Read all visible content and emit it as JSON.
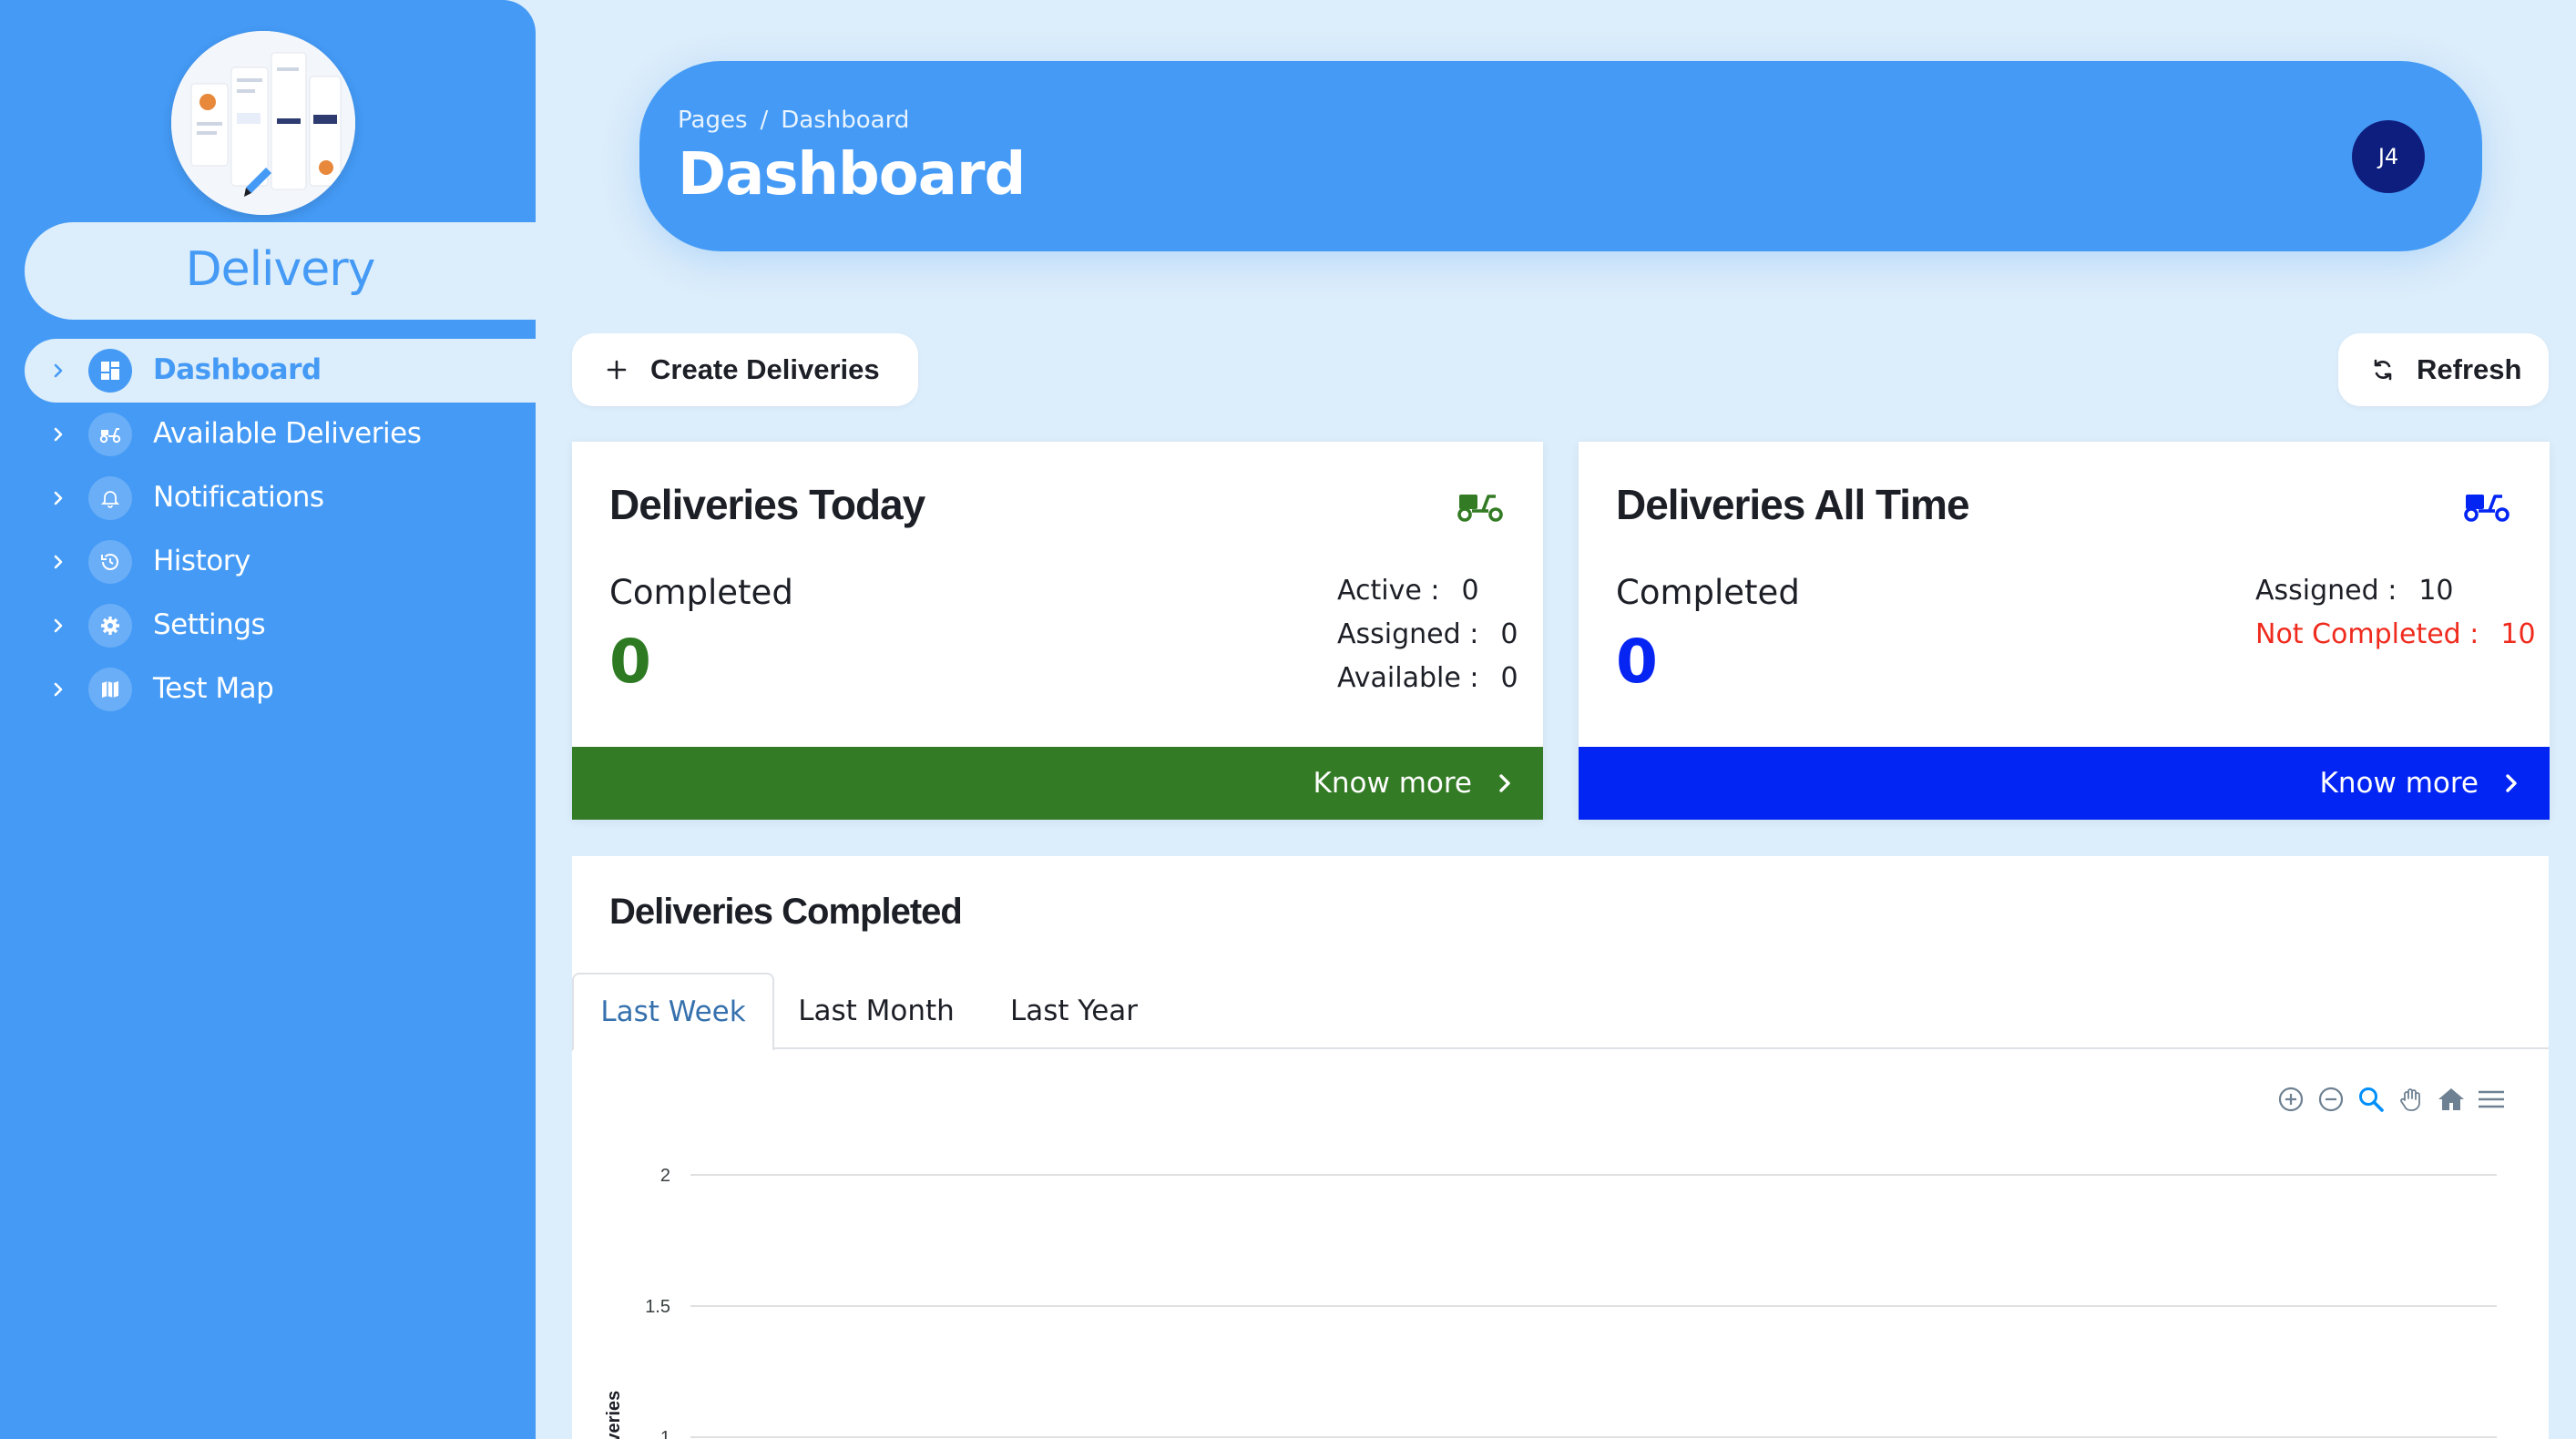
{
  "sidebar": {
    "brand": "Delivery",
    "items": [
      {
        "label": "Dashboard",
        "icon": "dashboard-grid-icon",
        "active": true
      },
      {
        "label": "Available Deliveries",
        "icon": "scooter-icon",
        "active": false
      },
      {
        "label": "Notifications",
        "icon": "bell-icon",
        "active": false
      },
      {
        "label": "History",
        "icon": "history-icon",
        "active": false
      },
      {
        "label": "Settings",
        "icon": "gear-icon",
        "active": false
      },
      {
        "label": "Test Map",
        "icon": "map-icon",
        "active": false
      }
    ]
  },
  "header": {
    "breadcrumb": [
      "Pages",
      "Dashboard"
    ],
    "separator": "/",
    "title": "Dashboard",
    "user_initials": "J4"
  },
  "actions": {
    "create_label": "Create Deliveries",
    "refresh_label": "Refresh"
  },
  "cards": {
    "today": {
      "title": "Deliveries Today",
      "completed_label": "Completed",
      "completed_value": "0",
      "stats": [
        {
          "label": "Active :",
          "value": "0"
        },
        {
          "label": "Assigned :",
          "value": "0"
        },
        {
          "label": "Available :",
          "value": "0"
        }
      ],
      "footer": "Know more",
      "color": "#337b24"
    },
    "all_time": {
      "title": "Deliveries All Time",
      "completed_label": "Completed",
      "completed_value": "0",
      "stats": [
        {
          "label": "Assigned :",
          "value": "10"
        },
        {
          "label": "Not Completed :",
          "value": "10"
        }
      ],
      "footer": "Know more",
      "color": "#0325f4"
    }
  },
  "chart_section": {
    "title": "Deliveries Completed",
    "tabs": [
      "Last Week",
      "Last Month",
      "Last Year"
    ],
    "active_tab": "Last Week",
    "toolbar": [
      "zoom-in-icon",
      "zoom-out-icon",
      "zoom-selection-icon",
      "pan-hand-icon",
      "reset-home-icon",
      "menu-icon"
    ]
  },
  "chart_data": {
    "type": "line",
    "ylabel": "Deliveries",
    "yticks": [
      "2",
      "1.5",
      "1"
    ],
    "ylim": [
      1,
      2
    ],
    "grid": true,
    "series": []
  },
  "colors": {
    "primary": "#449af5",
    "background": "#dcedfb",
    "green": "#337b24",
    "blue": "#0325f4",
    "danger": "#ef2b1e",
    "avatar": "#0e1e7e"
  }
}
